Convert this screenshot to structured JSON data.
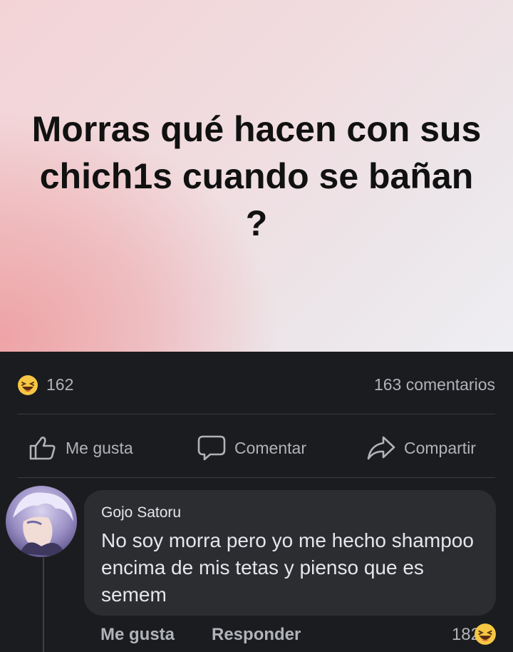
{
  "post": {
    "text": "Morras qué hacen con sus chich1s cuando se bañan ?",
    "reaction_count": "162",
    "comments_count": "163 comentarios"
  },
  "actions": {
    "like": "Me gusta",
    "comment": "Comentar",
    "share": "Compartir"
  },
  "comment": {
    "author": "Gojo Satoru",
    "text": "No soy morra pero yo me hecho shampoo encima de mis tetas y pienso que es semem",
    "like_label": "Me gusta",
    "reply_label": "Responder",
    "reaction_count": "182"
  },
  "icons": {
    "reaction": "haha-emoji-icon",
    "like": "thumbs-up-icon",
    "comment": "speech-bubble-icon",
    "share": "share-arrow-icon"
  },
  "colors": {
    "background": "#1b1c1f",
    "bubble": "#2b2d31",
    "muted_text": "#b0b3b8",
    "emoji_yellow": "#f7c744"
  }
}
